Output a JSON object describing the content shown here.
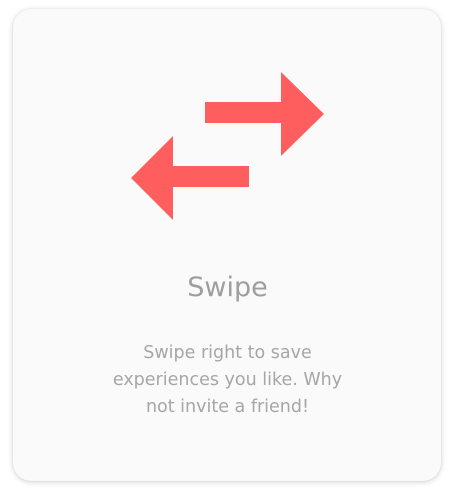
{
  "card": {
    "title": "Swipe",
    "description": "Swipe right to save experiences you like. Why not invite a friend!",
    "icon": "swap-arrows-icon"
  },
  "colors": {
    "accent": "#ff5e5e",
    "card_background": "#fafafa",
    "text": "#9e9e9e"
  }
}
